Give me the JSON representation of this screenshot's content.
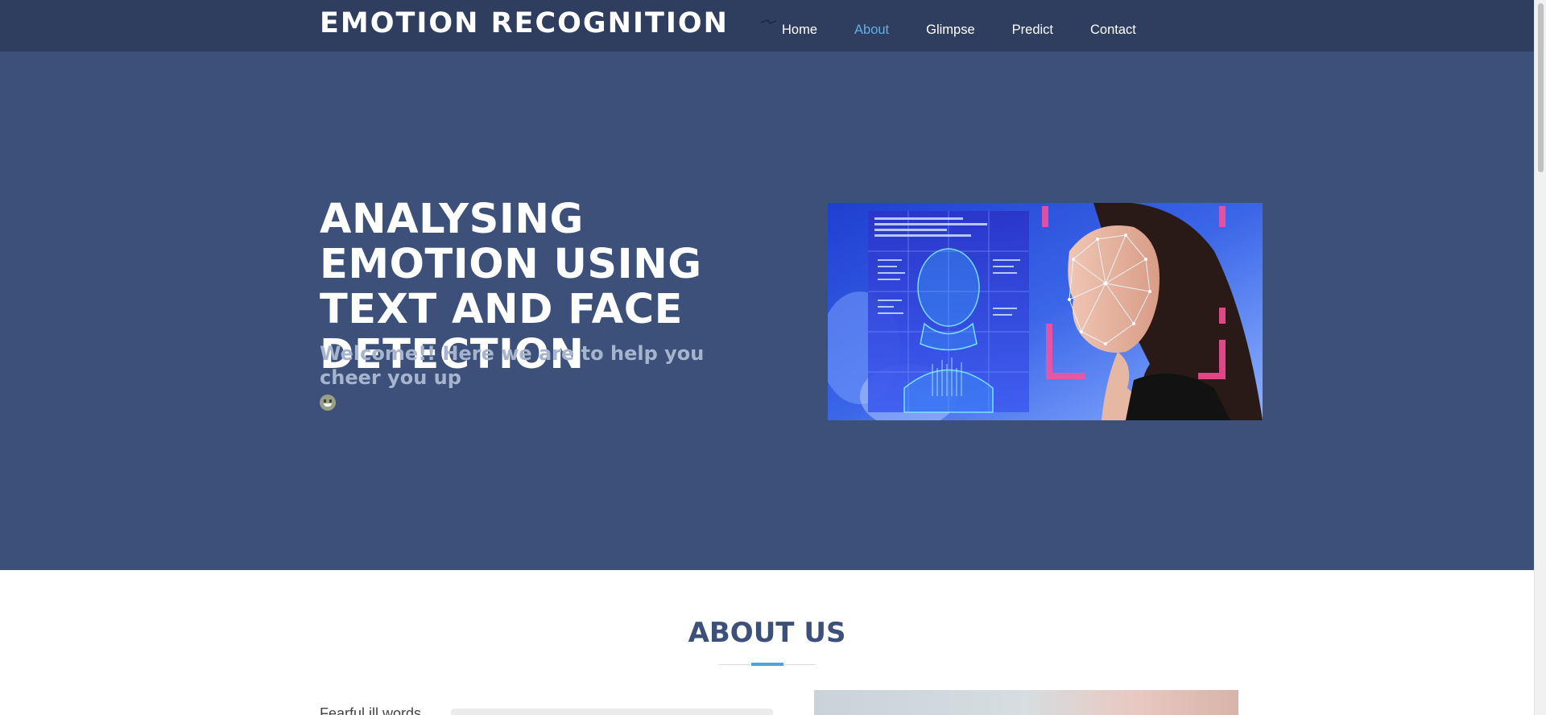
{
  "header": {
    "logo": "EMOTION RECOGNITION",
    "nav": [
      {
        "label": "Home",
        "active": false
      },
      {
        "label": "About",
        "active": true
      },
      {
        "label": "Glimpse",
        "active": false
      },
      {
        "label": "Predict",
        "active": false
      },
      {
        "label": "Contact",
        "active": false
      }
    ]
  },
  "hero": {
    "title": "ANALYSING EMOTION USING TEXT AND FACE DETECTION",
    "subtitle": "Welcome!! Here we are to help you cheer you up",
    "emoji": "grinning-face-emoji"
  },
  "about": {
    "title": "ABOUT US",
    "text": "Fearful ill words... "
  },
  "colors": {
    "header_bg": "#2f3d5f",
    "hero_bg": "#3c5079",
    "nav_active": "#5fb1e8",
    "about_title": "#3c5079",
    "accent_line": "#47a6dd"
  }
}
